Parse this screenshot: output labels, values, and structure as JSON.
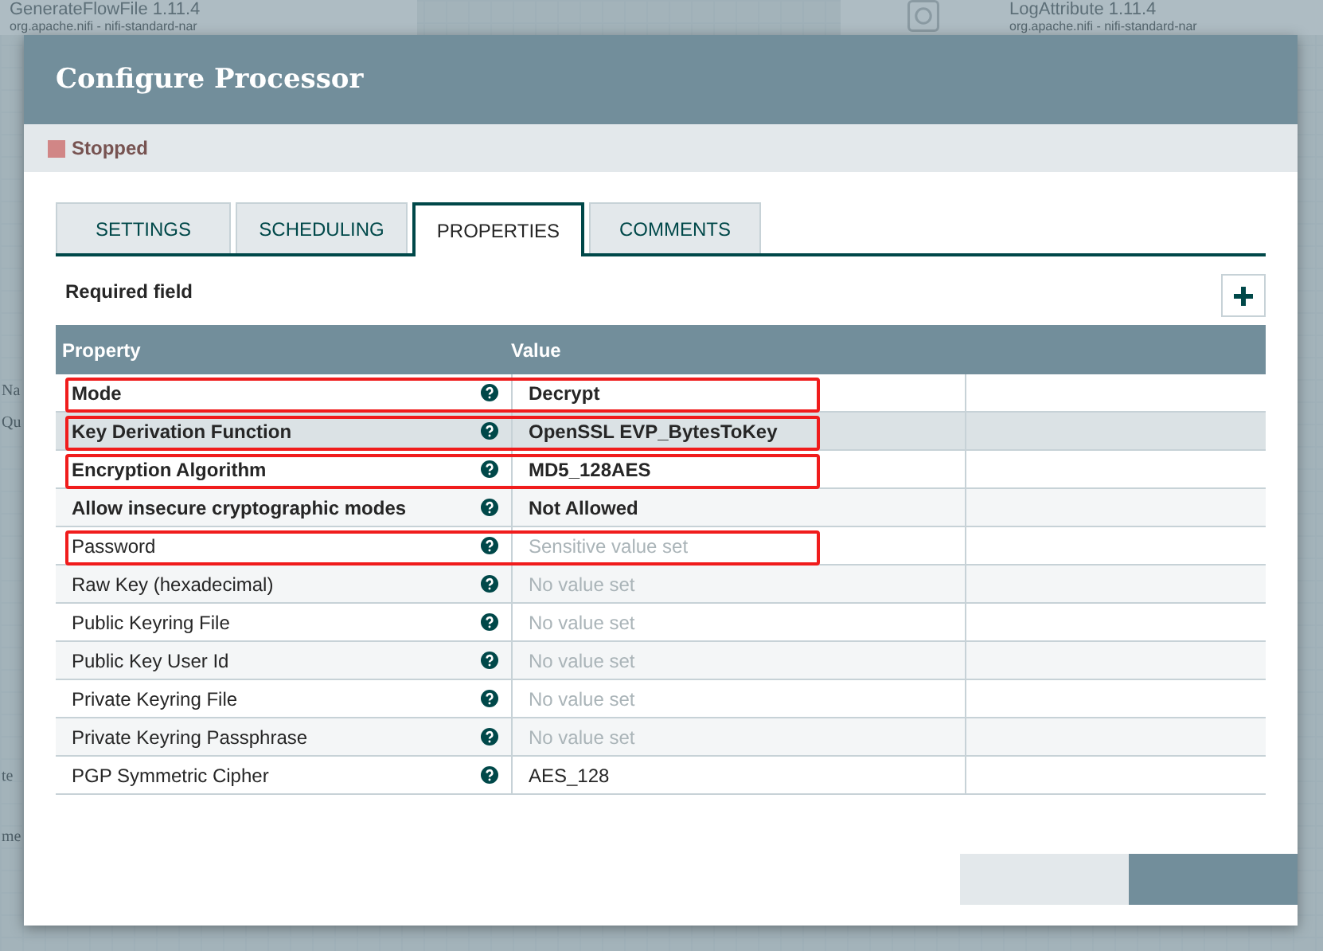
{
  "canvas": {
    "cards": [
      {
        "title": "GenerateFlowFile 1.11.4",
        "subtitle": "org.apache.nifi - nifi-standard-nar"
      },
      {
        "title": "LogAttribute 1.11.4",
        "subtitle": "org.apache.nifi - nifi-standard-nar"
      }
    ],
    "fragments": [
      "Na",
      "Qu",
      "te",
      "me"
    ]
  },
  "dialog": {
    "title": "Configure Processor",
    "status": {
      "label": "Stopped",
      "running": false
    },
    "tabs": [
      {
        "label": "SETTINGS",
        "selected": false
      },
      {
        "label": "SCHEDULING",
        "selected": false
      },
      {
        "label": "PROPERTIES",
        "selected": true
      },
      {
        "label": "COMMENTS",
        "selected": false
      }
    ],
    "required_note": "Required field",
    "table": {
      "columns": [
        "Property",
        "Value"
      ],
      "rows": [
        {
          "property": "Mode",
          "value": "Decrypt",
          "required": true,
          "value_set": true,
          "selected": false,
          "highlighted": true
        },
        {
          "property": "Key Derivation Function",
          "value": "OpenSSL EVP_BytesToKey",
          "required": true,
          "value_set": true,
          "selected": true,
          "highlighted": true
        },
        {
          "property": "Encryption Algorithm",
          "value": "MD5_128AES",
          "required": true,
          "value_set": true,
          "selected": false,
          "highlighted": true
        },
        {
          "property": "Allow insecure cryptographic modes",
          "value": "Not Allowed",
          "required": true,
          "value_set": true,
          "selected": false,
          "highlighted": false
        },
        {
          "property": "Password",
          "value": "Sensitive value set",
          "required": false,
          "value_set": false,
          "selected": false,
          "highlighted": true
        },
        {
          "property": "Raw Key (hexadecimal)",
          "value": "No value set",
          "required": false,
          "value_set": false,
          "selected": false,
          "highlighted": false
        },
        {
          "property": "Public Keyring File",
          "value": "No value set",
          "required": false,
          "value_set": false,
          "selected": false,
          "highlighted": false
        },
        {
          "property": "Public Key User Id",
          "value": "No value set",
          "required": false,
          "value_set": false,
          "selected": false,
          "highlighted": false
        },
        {
          "property": "Private Keyring File",
          "value": "No value set",
          "required": false,
          "value_set": false,
          "selected": false,
          "highlighted": false
        },
        {
          "property": "Private Keyring Passphrase",
          "value": "No value set",
          "required": false,
          "value_set": false,
          "selected": false,
          "highlighted": false
        },
        {
          "property": "PGP Symmetric Cipher",
          "value": "AES_128",
          "required": false,
          "value_set": true,
          "selected": false,
          "highlighted": false
        }
      ]
    }
  }
}
